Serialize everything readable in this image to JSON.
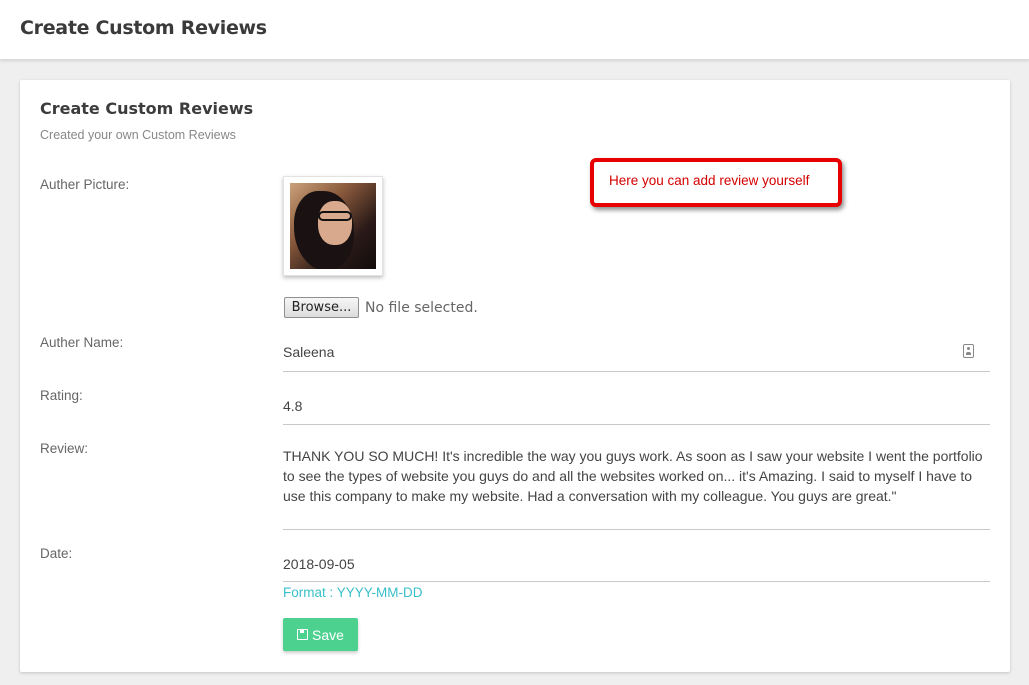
{
  "header": {
    "title": "Create Custom Reviews"
  },
  "card": {
    "title": "Create Custom Reviews",
    "subtitle": "Created your own Custom Reviews"
  },
  "form": {
    "picture_label": "Auther Picture:",
    "browse_label": "Browse...",
    "file_status": "No file selected.",
    "name_label": "Auther Name:",
    "name_value": "Saleena",
    "rating_label": "Rating:",
    "rating_value": "4.8",
    "review_label": "Review:",
    "review_value": "THANK YOU SO MUCH! It's incredible the way you guys work. As soon as I saw your website I went the portfolio to see the types of website you guys do and all the websites worked on... it's Amazing.  I said to myself I have to use this company to make my website. Had a conversation with my colleague. You guys are great.\"",
    "date_label": "Date:",
    "date_value": "2018-09-05",
    "date_format_hint": "Format : YYYY-MM-DD",
    "save_label": "Save"
  },
  "annotation": {
    "text": "Here you can add review yourself"
  },
  "colors": {
    "save_button": "#4cd18f",
    "format_hint": "#39bfc9",
    "annotation_border": "#e60000"
  },
  "icons": [
    "contact-card-icon",
    "floppy-disk-icon"
  ]
}
